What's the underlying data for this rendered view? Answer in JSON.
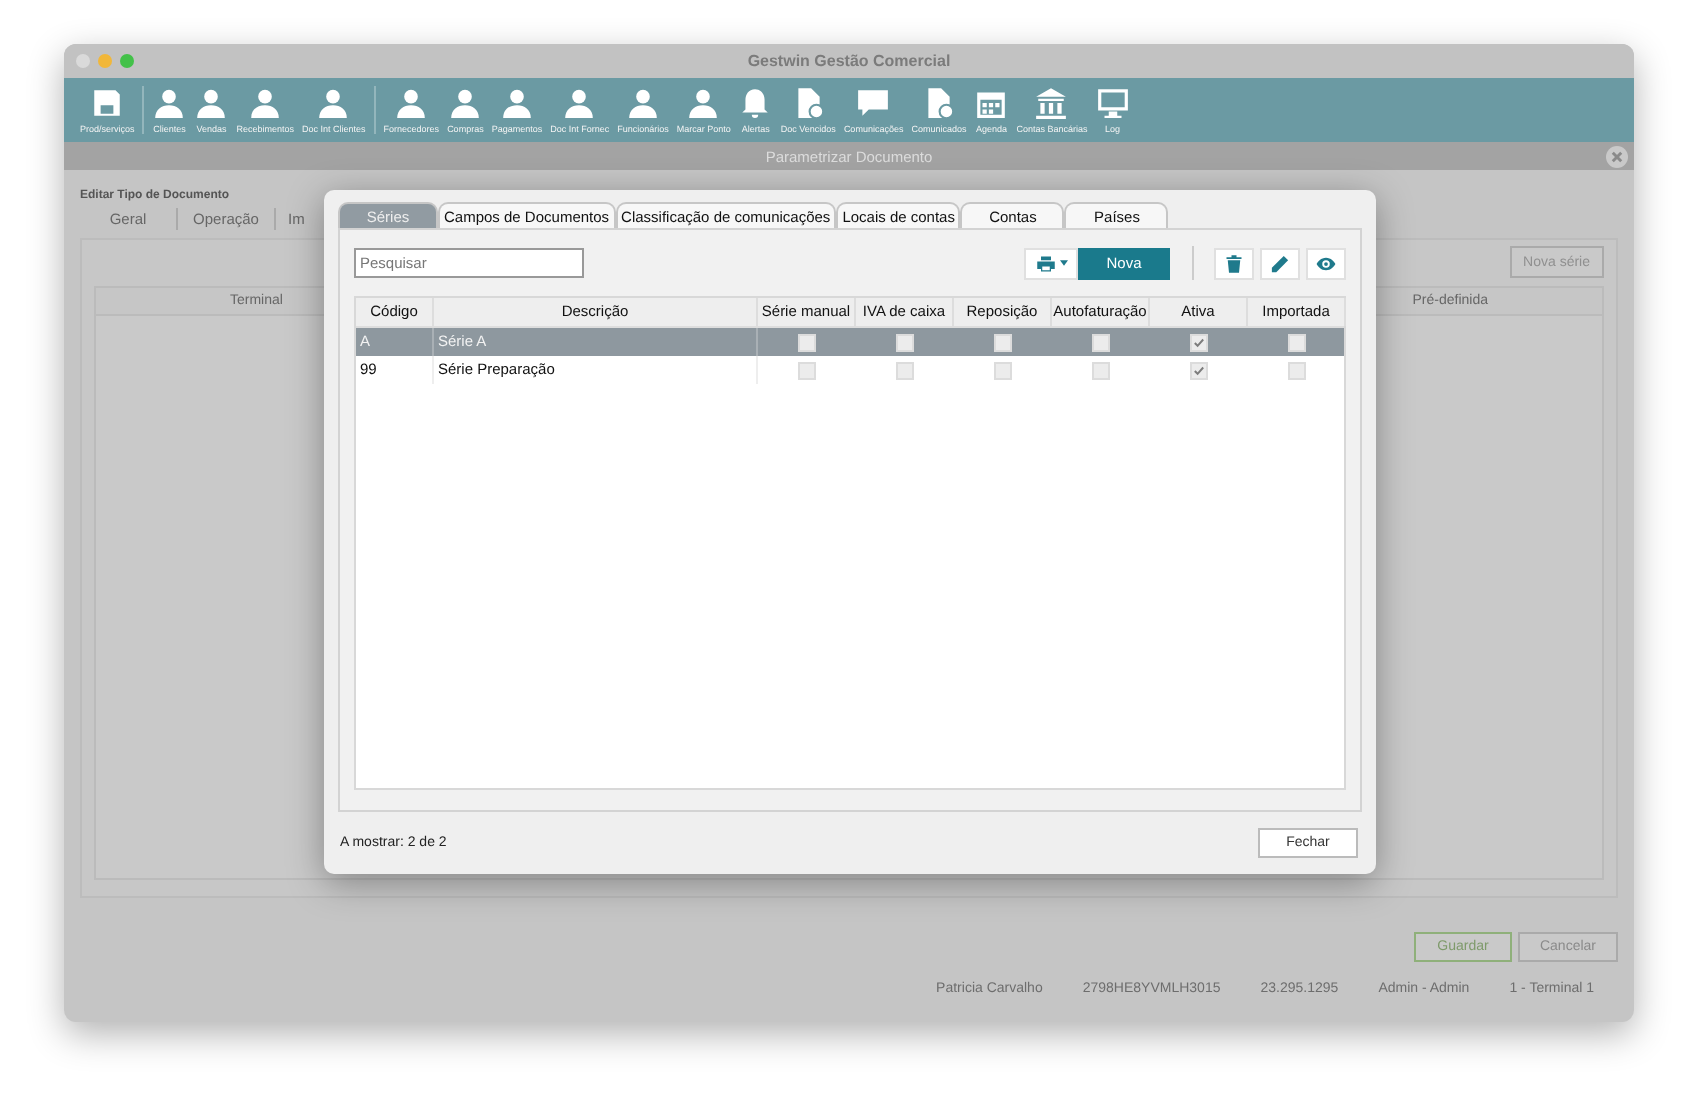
{
  "window": {
    "title": "Gestwin Gestão Comercial"
  },
  "toolbar": [
    {
      "kind": "save",
      "label": "Prod/serviços"
    },
    {
      "kind": "separator"
    },
    {
      "kind": "person",
      "label": "Clientes"
    },
    {
      "kind": "person",
      "label": "Vendas"
    },
    {
      "kind": "person",
      "label": "Recebimentos"
    },
    {
      "kind": "person",
      "label": "Doc Int Clientes"
    },
    {
      "kind": "separator"
    },
    {
      "kind": "person",
      "label": "Fornecedores"
    },
    {
      "kind": "person",
      "label": "Compras"
    },
    {
      "kind": "person",
      "label": "Pagamentos"
    },
    {
      "kind": "person",
      "label": "Doc Int Fornec"
    },
    {
      "kind": "person",
      "label": "Funcionários"
    },
    {
      "kind": "person",
      "label": "Marcar Ponto"
    },
    {
      "kind": "bell",
      "label": "Alertas"
    },
    {
      "kind": "document",
      "label": "Doc Vencidos"
    },
    {
      "kind": "chat",
      "label": "Comunicações"
    },
    {
      "kind": "document",
      "label": "Comunicados"
    },
    {
      "kind": "calendar",
      "label": "Agenda"
    },
    {
      "kind": "bank",
      "label": "Contas Bancárias"
    },
    {
      "kind": "monitor",
      "label": "Log"
    }
  ],
  "subheader": {
    "title": "Parametrizar Documento"
  },
  "editor": {
    "title": "Editar Tipo de Documento",
    "tabs": [
      {
        "label": "Geral",
        "selected": false
      },
      {
        "label": "Operação",
        "selected": false
      },
      {
        "label": "Im",
        "selected": false
      }
    ],
    "new_button": {
      "label": "Nova série",
      "disabled": true
    },
    "columns": [
      "Terminal",
      "Pré-definida"
    ]
  },
  "actions": [
    {
      "label": "Guardar",
      "kind": "primary"
    },
    {
      "label": "Cancelar",
      "kind": "secondary"
    }
  ],
  "status_bar": [
    "Patricia Carvalho",
    "2798HE8YVMLH3015",
    "23.295.1295",
    "Admin - Admin",
    "1 - Terminal 1"
  ],
  "dialog": {
    "tabs": [
      {
        "label": "Séries",
        "selected": true
      },
      {
        "label": "Campos de Documentos",
        "selected": false
      },
      {
        "label": "Classificação de comunicações",
        "selected": false
      },
      {
        "label": "Locais de contas",
        "selected": false
      },
      {
        "label": "Contas",
        "selected": false
      },
      {
        "label": "Países",
        "selected": false
      }
    ],
    "search": {
      "placeholder": "Pesquisar"
    },
    "new_button": "Nova",
    "columns": [
      "Código",
      "Descrição",
      "Série manual",
      "IVA de caixa",
      "Reposição",
      "Autofaturação",
      "Ativa",
      "Importada"
    ],
    "rows": [
      {
        "code": "A",
        "description": "Série A",
        "selected": true,
        "flags": [
          false,
          false,
          false,
          false,
          true,
          false
        ]
      },
      {
        "code": "99",
        "description": "Série Preparação",
        "selected": false,
        "flags": [
          false,
          false,
          false,
          false,
          true,
          false
        ]
      }
    ],
    "count": "A mostrar: 2 de 2",
    "close_button": "Fechar"
  }
}
